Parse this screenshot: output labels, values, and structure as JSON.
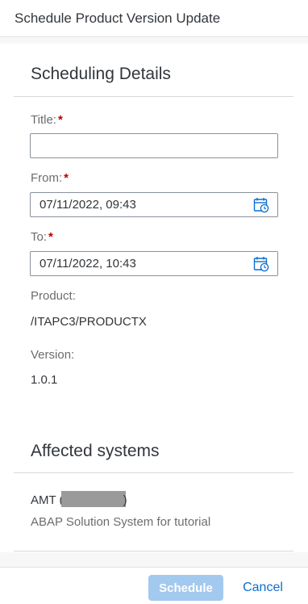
{
  "dialog": {
    "title": "Schedule Product Version Update"
  },
  "scheduling": {
    "heading": "Scheduling Details",
    "title_label": "Title:",
    "title_value": "",
    "from_label": "From:",
    "from_value": "07/11/2022, 09:43",
    "to_label": "To:",
    "to_value": "07/11/2022, 10:43",
    "required_mark": "*",
    "product_label": "Product:",
    "product_value": "/ITAPC3/PRODUCTX",
    "version_label": "Version:",
    "version_value": "1.0.1"
  },
  "affected": {
    "heading": "Affected systems",
    "systems": [
      {
        "name_prefix": "AMT (",
        "name_suffix": ")",
        "description": "ABAP Solution System for tutorial"
      }
    ]
  },
  "footer": {
    "schedule_label": "Schedule",
    "cancel_label": "Cancel"
  },
  "colors": {
    "primary_disabled": "#a3c9ef",
    "link": "#0a6ed1",
    "required": "#bb0000",
    "calendar_icon": "#0a6ed1"
  },
  "icons": {
    "date_picker": "calendar-icon"
  }
}
